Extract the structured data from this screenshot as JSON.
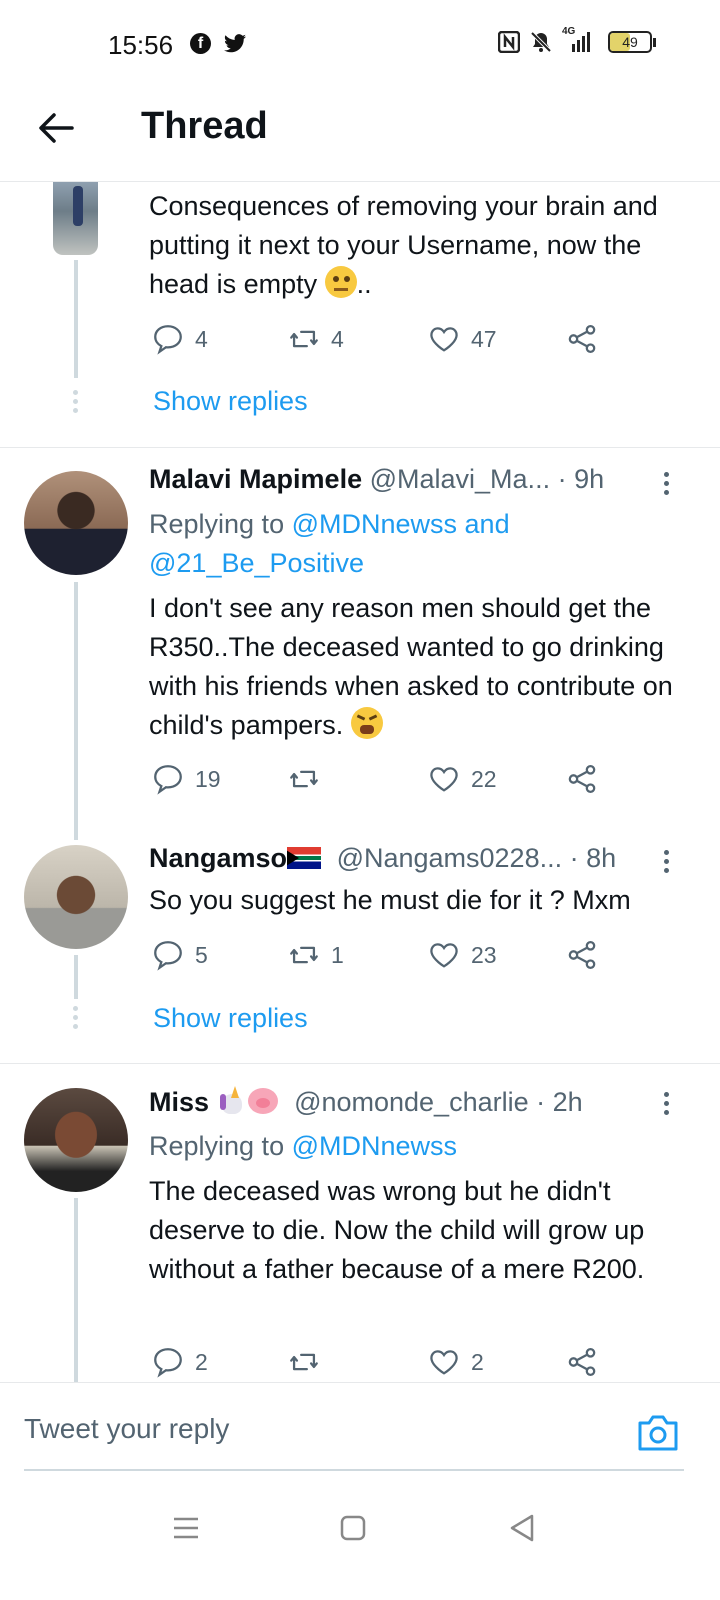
{
  "status_bar": {
    "time": "15:56",
    "network": "4G",
    "battery": "49"
  },
  "header": {
    "title": "Thread"
  },
  "tweets": [
    {
      "body": "Consequences of removing your brain and putting it next to your Username, now the head is empty",
      "trailing": "..",
      "emoji_icon": "face-with-rolling-eyes",
      "replies": "4",
      "retweets": "4",
      "likes": "47",
      "show_replies": "Show replies"
    },
    {
      "name": "Malavi Mapimele",
      "handle": "@Malavi_Ma...",
      "time": "· 9h",
      "replying_prefix": "Replying to",
      "replying_to": "@MDNnewss and",
      "replying_to_2": "@21_Be_Positive",
      "body": "I don't see any reason men should get the R350..The deceased wanted to go drinking with his friends when asked to contribute on child's pampers.",
      "emoji_icon": "tired-face",
      "replies": "19",
      "retweets": "",
      "likes": "22"
    },
    {
      "name": "Nangamso",
      "name_emoji": "south-africa-flag",
      "handle": "@Nangams0228...",
      "time": "· 8h",
      "body": "So you suggest he must die for it ? Mxm",
      "replies": "5",
      "retweets": "1",
      "likes": "23",
      "show_replies": "Show replies"
    },
    {
      "name": "Miss",
      "name_emoji": "unicorn-pig",
      "handle": "@nomonde_charlie",
      "time": "· 2h",
      "replying_prefix": "Replying to",
      "replying_to": "@MDNnewss",
      "body": "The deceased was wrong but he didn't deserve to die. Now the child will grow up without a father because of a mere R200.",
      "replies": "2",
      "retweets": "",
      "likes": "2"
    }
  ],
  "reply_box": {
    "placeholder": "Tweet your reply"
  },
  "colors": {
    "accent": "#1d9bf0",
    "secondary_text": "#536471",
    "divider": "#e7e9eb"
  }
}
